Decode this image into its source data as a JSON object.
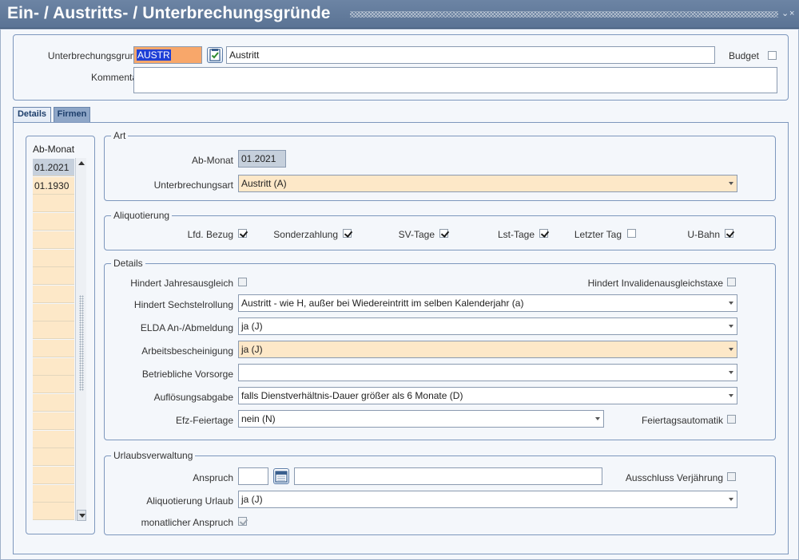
{
  "window": {
    "title": "Ein- / Austritts- / Unterbrechungsgründe",
    "min_glyph": "⌄",
    "close_glyph": "×"
  },
  "header": {
    "reason_label": "Unterbrechungsgrund",
    "reason_code": "AUSTR",
    "reason_text": "Austritt",
    "budget_label": "Budget",
    "comment_label": "Kommentar",
    "comment_value": ""
  },
  "tabs": [
    {
      "label": "Details",
      "active": true
    },
    {
      "label": "Firmen",
      "active": false
    }
  ],
  "month_list": {
    "header": "Ab-Monat",
    "items": [
      "01.2021",
      "01.1930"
    ]
  },
  "art": {
    "legend": "Art",
    "from_month_label": "Ab-Monat",
    "from_month_value": "01.2021",
    "type_label": "Unterbrechungsart",
    "type_value": "Austritt (A)"
  },
  "aliquot": {
    "legend": "Aliquotierung",
    "items": [
      {
        "label": "Lfd. Bezug",
        "checked": true
      },
      {
        "label": "Sonderzahlung",
        "checked": true
      },
      {
        "label": "SV-Tage",
        "checked": true
      },
      {
        "label": "Lst-Tage",
        "checked": true
      },
      {
        "label": "Letzter Tag",
        "checked": false
      },
      {
        "label": "U-Bahn",
        "checked": true
      }
    ]
  },
  "details": {
    "legend": "Details",
    "hinders_annual": {
      "label": "Hindert Jahresausgleich",
      "checked": false
    },
    "hinders_invalid": {
      "label": "Hindert Invalidenausgleichstaxe",
      "checked": false
    },
    "sechstel": {
      "label": "Hindert Sechstelrollung",
      "value": "Austritt - wie H, außer bei Wiedereintritt im selben Kalenderjahr (a)"
    },
    "elda": {
      "label": "ELDA An-/Abmeldung",
      "value": "ja (J)"
    },
    "work_cert": {
      "label": "Arbeitsbescheinigung",
      "value": "ja (J)"
    },
    "pension": {
      "label": "Betriebliche Vorsorge",
      "value": ""
    },
    "termination_fee": {
      "label": "Auflösungsabgabe",
      "value": "falls Dienstverhältnis-Dauer größer als 6 Monate (D)"
    },
    "efz_holidays": {
      "label": "Efz-Feiertage",
      "value": "nein (N)"
    },
    "holiday_auto": {
      "label": "Feiertagsautomatik",
      "checked": false
    }
  },
  "vacation": {
    "legend": "Urlaubsverwaltung",
    "claim_label": "Anspruch",
    "claim_value": "",
    "claim_text": "",
    "exclusion_label": "Ausschluss Verjährung",
    "exclusion_checked": false,
    "aliquot_label": "Aliquotierung Urlaub",
    "aliquot_value": "ja (J)",
    "monthly_label": "monatlicher Anspruch",
    "monthly_checked": true
  }
}
